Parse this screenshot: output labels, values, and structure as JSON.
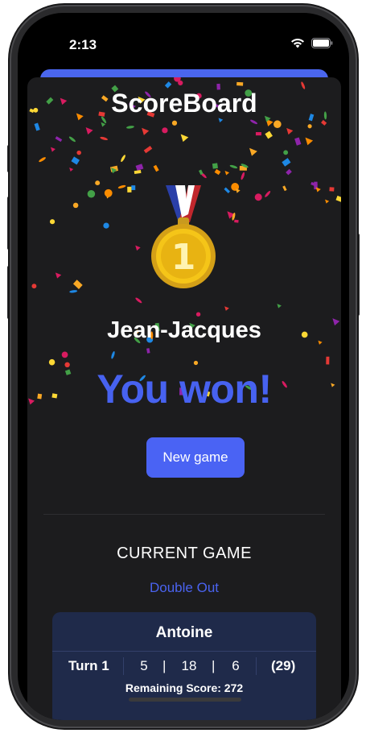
{
  "status_bar": {
    "time": "2:13"
  },
  "app": {
    "title": "ScoreBoard"
  },
  "winner": {
    "name": "Jean-Jacques",
    "message": "You won!",
    "medal_rank": "1"
  },
  "actions": {
    "new_game": "New game"
  },
  "current_game": {
    "heading": "CURRENT GAME",
    "mode": "Double Out",
    "players": [
      {
        "name": "Antoine",
        "turn_label": "Turn 1",
        "throws": [
          "5",
          "18",
          "6"
        ],
        "turn_total": "(29)",
        "remaining_score": "Remaining Score: 272"
      }
    ]
  },
  "colors": {
    "accent": "#4762f0",
    "sheet_background": "#1c1c1e",
    "card_background": "#1f2a4a"
  },
  "icons": [
    "wifi-icon",
    "battery-icon",
    "medal-icon"
  ]
}
